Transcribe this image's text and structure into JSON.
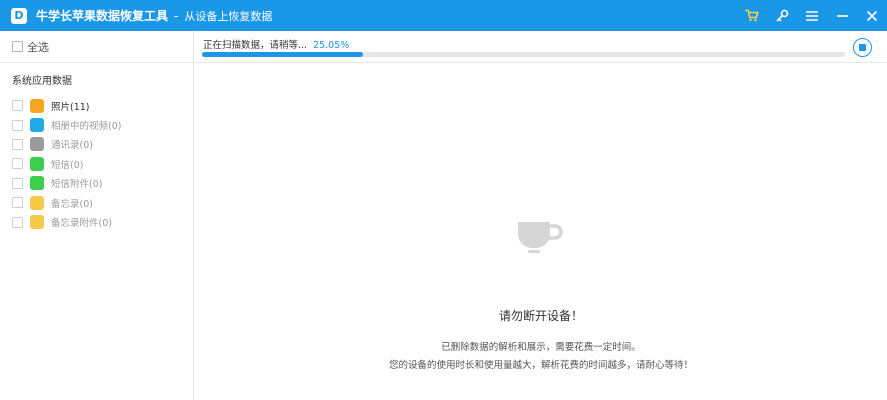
{
  "titlebar": {
    "logo_letter": "D",
    "app_title": "牛学长苹果数据恢复工具",
    "separator": "-",
    "subtitle": "从设备上恢复数据",
    "bg_color": "#1b97e8"
  },
  "sidebar": {
    "select_all_label": "全选",
    "section_title": "系统应用数据",
    "items": [
      {
        "label": "照片(11)",
        "icon": "photos-icon",
        "color": "#f5a623"
      },
      {
        "label": "相册中的视频(0)",
        "icon": "album-video-icon",
        "color": "#1fa9e5"
      },
      {
        "label": "通讯录(0)",
        "icon": "contacts-icon",
        "color": "#9b9b9b"
      },
      {
        "label": "短信(0)",
        "icon": "messages-icon",
        "color": "#3ccf4e"
      },
      {
        "label": "短信附件(0)",
        "icon": "message-attachments-icon",
        "color": "#3ccf4e"
      },
      {
        "label": "备忘录(0)",
        "icon": "notes-icon",
        "color": "#f7c948"
      },
      {
        "label": "备忘录附件(0)",
        "icon": "notes-attachments-icon",
        "color": "#f7c948"
      }
    ]
  },
  "progress": {
    "status_text": "正在扫描数据，请稍等...",
    "percent_text": "25.05%",
    "value": 0.2505
  },
  "notice": {
    "title": "请勿断开设备！",
    "line1": "已删除数据的解析和展示，需要花费一定时间。",
    "line2": "您的设备的使用时长和使用量越大，解析花费的时间越多，请耐心等待！"
  }
}
